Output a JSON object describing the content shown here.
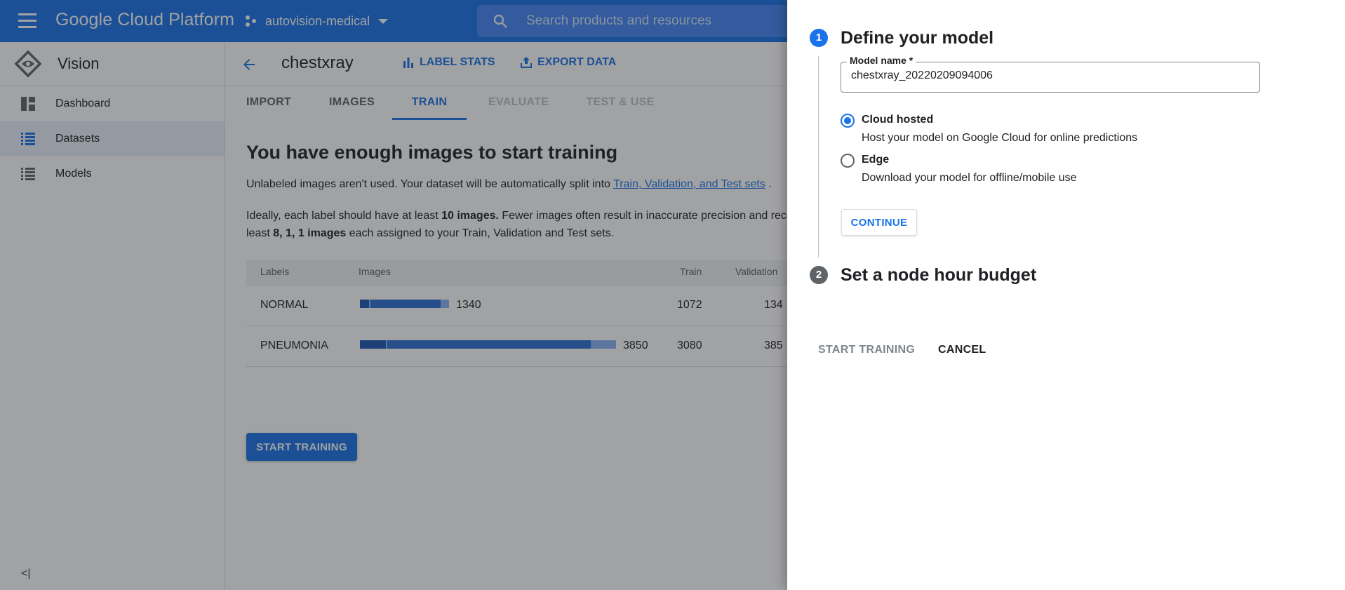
{
  "topbar": {
    "brand": "Google Cloud Platform",
    "project": "autovision-medical",
    "search_placeholder": "Search products and resources"
  },
  "sidebar": {
    "product": "Vision",
    "items": [
      {
        "label": "Dashboard",
        "icon": "dashboard-icon"
      },
      {
        "label": "Datasets",
        "icon": "list-icon",
        "active": true
      },
      {
        "label": "Models",
        "icon": "list-icon"
      }
    ],
    "collapse_glyph": "<|"
  },
  "header": {
    "dataset_title": "chestxray",
    "label_stats": "LABEL STATS",
    "export_data": "EXPORT DATA"
  },
  "tabs": [
    "IMPORT",
    "IMAGES",
    "TRAIN",
    "EVALUATE",
    "TEST & USE"
  ],
  "content": {
    "title": "You have enough images to start training",
    "p1_text": "Unlabeled images aren't used. Your dataset will be automatically split into ",
    "p1_link": "Train, Validation, and Test sets",
    "p1_end": " .",
    "p2_a": "Ideally, each label should have at least ",
    "p2_b": "10 images.",
    "p2_c": " Fewer images often result in inaccurate precision and recall. Each label should have at",
    "p2_d": "least ",
    "p2_e": "8, 1, 1 images",
    "p2_f": " each assigned to your Train, Validation and Test sets."
  },
  "table": {
    "headers": [
      "Labels",
      "Images",
      "Train",
      "Validation"
    ],
    "rows": [
      {
        "label": "NORMAL",
        "images": "1340",
        "train": "1072",
        "validation": "134",
        "fraction": 0.348
      },
      {
        "label": "PNEUMONIA",
        "images": "3850",
        "train": "3080",
        "validation": "385",
        "fraction": 1.0
      }
    ],
    "colors": {
      "train": "#1a56b4",
      "validation": "#2a6fd6",
      "test": "#8ab4f8"
    }
  },
  "start_training_main": "START TRAINING",
  "panel": {
    "step1_num": "1",
    "step1_title": "Define your model",
    "model_name_label": "Model name *",
    "model_name_value": "chestxray_20220209094006",
    "option1_title": "Cloud hosted",
    "option1_desc": "Host your model on Google Cloud for online predictions",
    "option2_title": "Edge",
    "option2_desc": "Download your model for offline/mobile use",
    "continue": "CONTINUE",
    "step2_num": "2",
    "step2_title": "Set a node hour budget",
    "start_training": "START TRAINING",
    "cancel": "CANCEL"
  },
  "colors": {
    "primary": "#1a73e8",
    "scrim": "rgba(32,33,36,0.42)"
  }
}
